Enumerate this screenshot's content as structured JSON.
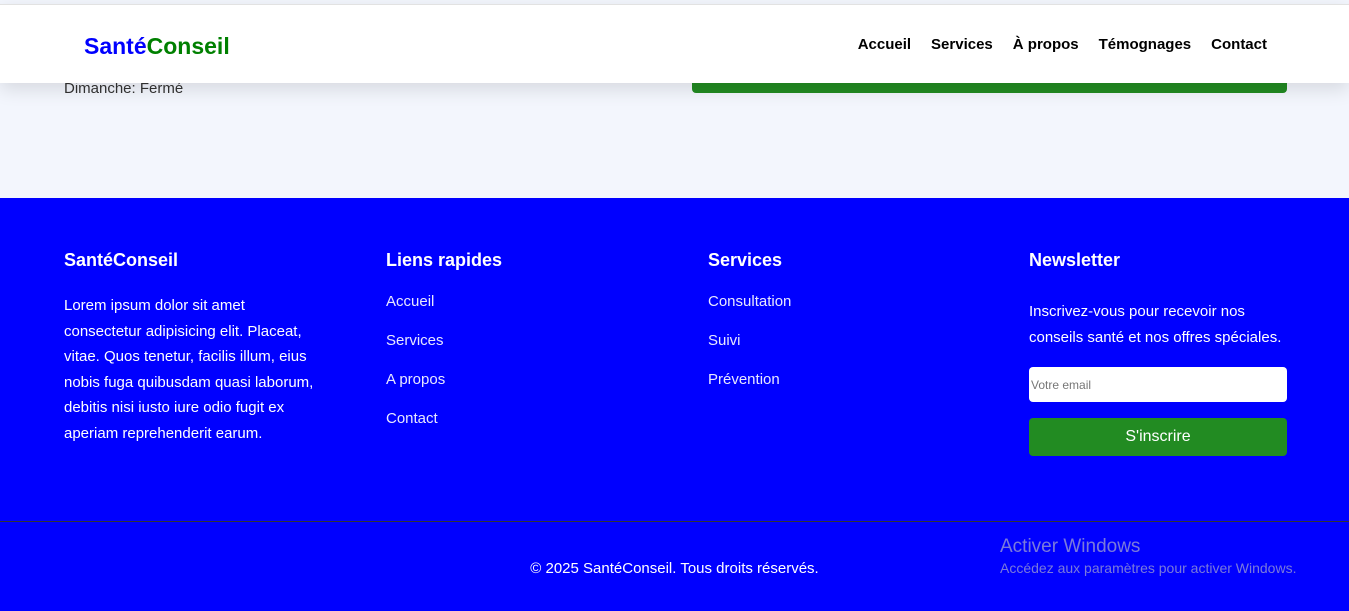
{
  "header": {
    "logo_part1": "Santé",
    "logo_part2": "Conseil",
    "nav": [
      "Accueil",
      "Services",
      "À propos",
      "Témognages",
      "Contact"
    ]
  },
  "contact": {
    "hours_line": "Dimanche: Fermé"
  },
  "footer": {
    "about": {
      "title": "SantéConseil",
      "text": "Lorem ipsum dolor sit amet consectetur adipisicing elit. Placeat, vitae. Quos tenetur, facilis illum, eius nobis fuga quibusdam quasi laborum, debitis nisi iusto iure odio fugit ex aperiam reprehenderit earum."
    },
    "links": {
      "title": "Liens rapides",
      "items": [
        "Accueil",
        "Services",
        "A propos",
        "Contact"
      ]
    },
    "services": {
      "title": "Services",
      "items": [
        "Consultation",
        "Suivi",
        "Prévention"
      ]
    },
    "newsletter": {
      "title": "Newsletter",
      "text": "Inscrivez-vous pour recevoir nos conseils santé et nos offres spéciales.",
      "placeholder": "Votre email",
      "button": "S'inscrire"
    },
    "copyright": "© 2025 SantéConseil. Tous droits réservés."
  },
  "watermark": {
    "title": "Activer Windows",
    "subtitle": "Accédez aux paramètres pour activer Windows."
  }
}
